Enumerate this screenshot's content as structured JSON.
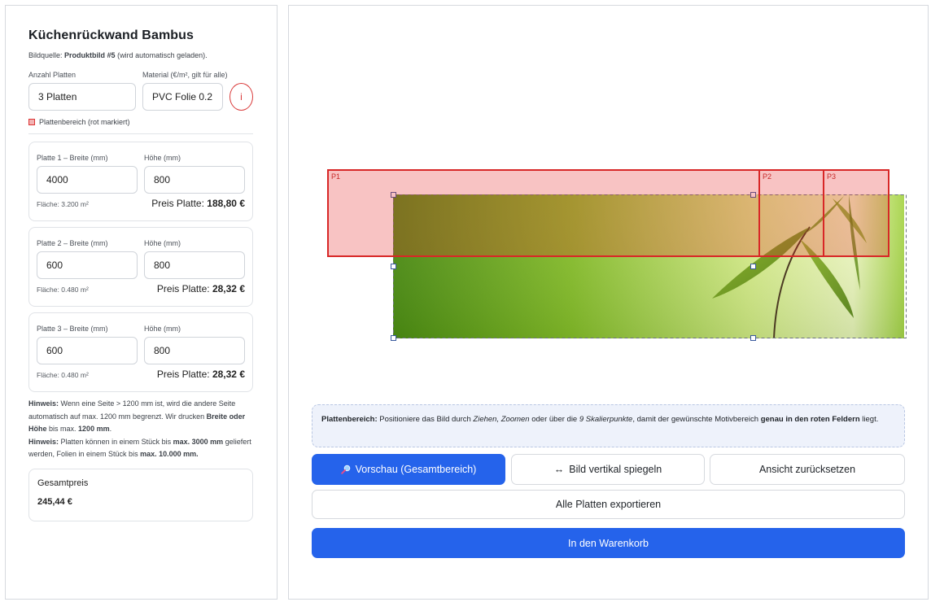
{
  "sidebar": {
    "title": "Küchenrückwand Bambus",
    "source_prefix": "Bildquelle:",
    "source_name": "Produktbild #5",
    "source_suffix": "(wird automatisch geladen).",
    "count_label": "Anzahl Platten",
    "count_value": "3 Platten",
    "material_label": "Material (€/m², gilt für alle)",
    "material_value": "PVC Folie 0.2",
    "info_glyph": "i",
    "legend_label": "Plattenbereich (rot markiert)",
    "plates": [
      {
        "width_label": "Platte 1 – Breite (mm)",
        "width": "4000",
        "height_label": "Höhe (mm)",
        "height": "800",
        "area": "Fläche: 3.200 m²",
        "price_label": "Preis Platte:",
        "price": "188,80 €"
      },
      {
        "width_label": "Platte 2 – Breite (mm)",
        "width": "600",
        "height_label": "Höhe (mm)",
        "height": "800",
        "area": "Fläche: 0.480 m²",
        "price_label": "Preis Platte:",
        "price": "28,32 €"
      },
      {
        "width_label": "Platte 3 – Breite (mm)",
        "width": "600",
        "height_label": "Höhe (mm)",
        "height": "800",
        "area": "Fläche: 0.480 m²",
        "price_label": "Preis Platte:",
        "price": "28,32 €"
      }
    ],
    "hint1_title": "Hinweis:",
    "hint1_text_a": "Wenn eine Seite > 1200 mm ist, wird die andere Seite automatisch auf max. 1200 mm begrenzt. Wir drucken",
    "hint1_bold": "Breite oder Höhe",
    "hint1_text_b": "bis max.",
    "hint1_bold2": "1200 mm",
    "hint2_title": "Hinweis:",
    "hint2_text_a": "Platten können in einem Stück bis",
    "hint2_bold": "max. 3000 mm",
    "hint2_text_b": "geliefert werden, Folien in einem Stück bis",
    "hint2_bold2": "max. 10.000 mm.",
    "total_label": "Gesamtpreis",
    "total_value": "245,44 €"
  },
  "canvas": {
    "plate_tags": [
      "P1",
      "P2",
      "P3"
    ]
  },
  "note": {
    "b1": "Plattenbereich:",
    "t1": "Positioniere das Bild durch",
    "i1": "Ziehen, Zoomen",
    "t2": "oder über die",
    "i2": "9 Skalierpunkte",
    "t3": ", damit der gewünschte Motivbereich",
    "b2": "genau in den roten Feldern",
    "t4": "liegt."
  },
  "buttons": {
    "preview_icon": "magnifier-icon",
    "preview": "Vorschau (Gesamtbereich)",
    "flip_glyph": "↔",
    "flip": "Bild vertikal spiegeln",
    "reset": "Ansicht zurücksetzen",
    "export": "Alle Platten exportieren",
    "cart": "In den Warenkorb"
  },
  "colors": {
    "accent": "#2563eb",
    "plate_border": "#d82727",
    "info": "#d93a3a"
  }
}
